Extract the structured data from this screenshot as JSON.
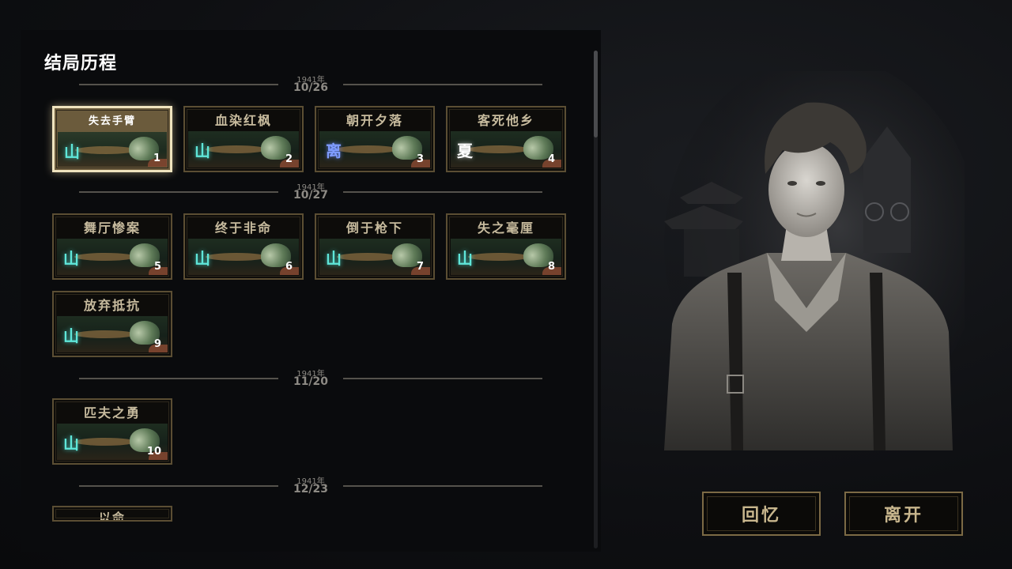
{
  "panel": {
    "title": "结局历程"
  },
  "date_groups": [
    {
      "year": "1941年",
      "date": "10/26",
      "endings": [
        {
          "title": "失去手臂",
          "glyph": "山",
          "glyph_type": "mountain",
          "number": "1",
          "selected": true
        },
        {
          "title": "血染红枫",
          "glyph": "山",
          "glyph_type": "mountain",
          "number": "2"
        },
        {
          "title": "朝开夕落",
          "glyph": "离",
          "glyph_type": "departure",
          "number": "3"
        },
        {
          "title": "客死他乡",
          "glyph": "夏",
          "glyph_type": "summer",
          "number": "4"
        }
      ]
    },
    {
      "year": "1941年",
      "date": "10/27",
      "endings": [
        {
          "title": "舞厅惨案",
          "glyph": "山",
          "glyph_type": "mountain",
          "number": "5"
        },
        {
          "title": "终于非命",
          "glyph": "山",
          "glyph_type": "mountain",
          "number": "6"
        },
        {
          "title": "倒于枪下",
          "glyph": "山",
          "glyph_type": "mountain",
          "number": "7"
        },
        {
          "title": "失之毫厘",
          "glyph": "山",
          "glyph_type": "mountain",
          "number": "8"
        },
        {
          "title": "放弃抵抗",
          "glyph": "山",
          "glyph_type": "mountain",
          "number": "9"
        }
      ]
    },
    {
      "year": "1941年",
      "date": "11/20",
      "endings": [
        {
          "title": "匹夫之勇",
          "glyph": "山",
          "glyph_type": "mountain",
          "number": "10"
        }
      ]
    },
    {
      "year": "1941年",
      "date": "12/23",
      "endings": [
        {
          "title": "以命",
          "partially_visible": true
        }
      ]
    }
  ],
  "buttons": {
    "recall": "回忆",
    "leave": "离开"
  },
  "character": {
    "description": "black-and-white portrait of young man in striped jacket with suspenders"
  },
  "colors": {
    "accent_gold": "#7c6a45",
    "card_border": "#5b4e33",
    "selected_border": "#efe3be",
    "glyph_mountain": "#5fe6d9",
    "glyph_departure": "#7f9cff"
  }
}
